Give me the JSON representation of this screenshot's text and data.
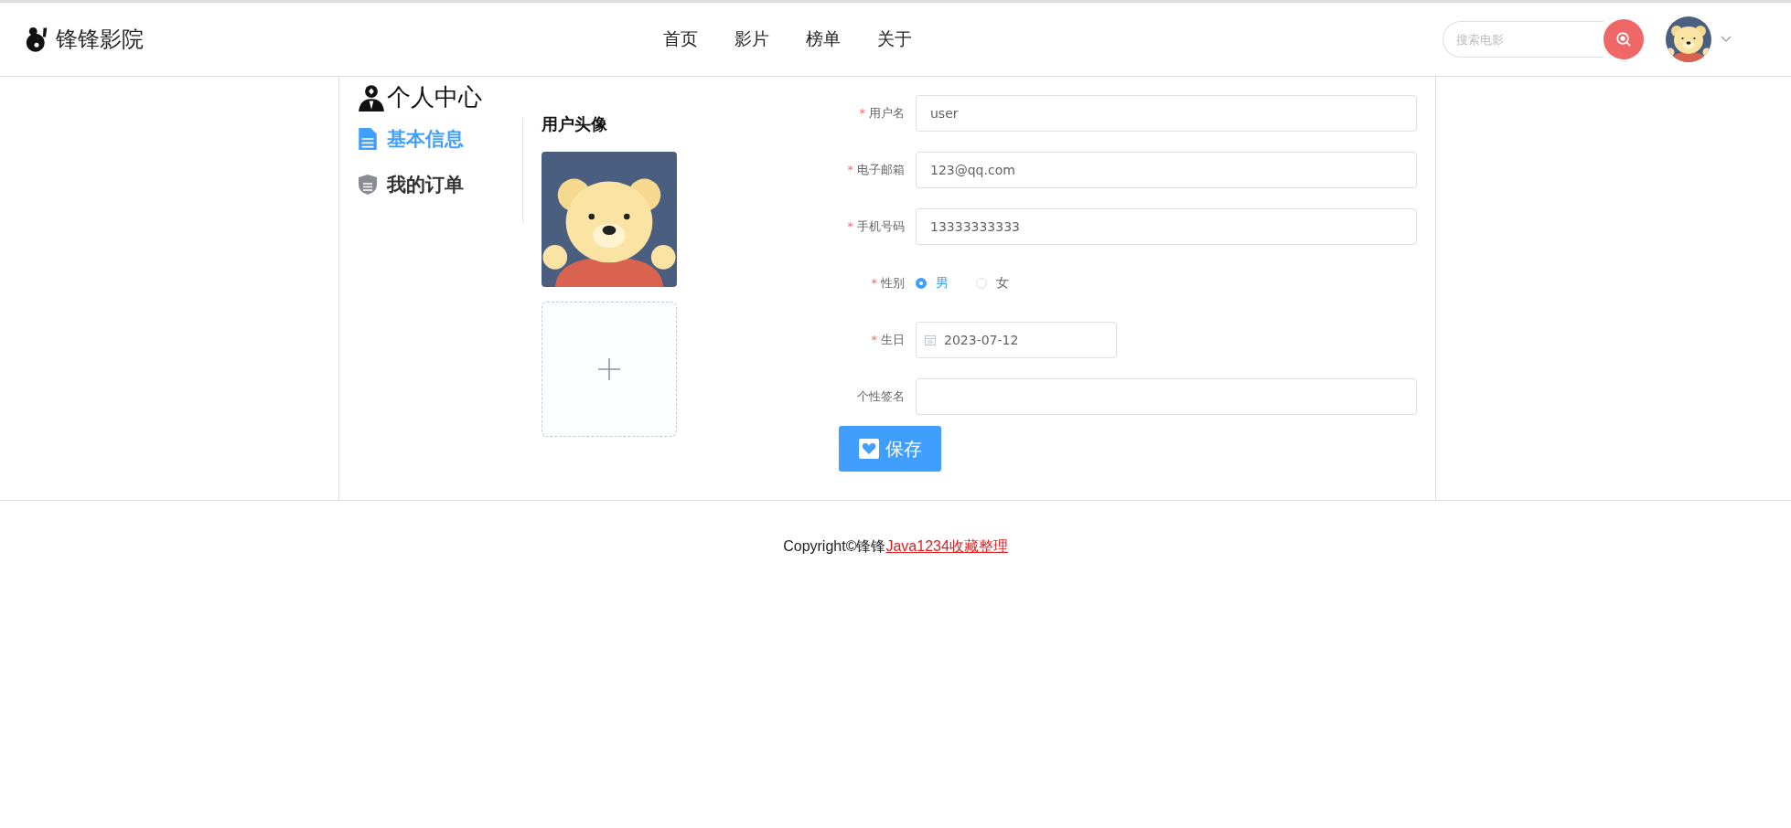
{
  "header": {
    "logo": "锋锋影院",
    "nav": [
      {
        "label": "首页",
        "selected": false
      },
      {
        "label": "影片",
        "selected": false
      },
      {
        "label": "榜单",
        "selected": false
      },
      {
        "label": "关于",
        "selected": false
      }
    ],
    "search": {
      "placeholder": "搜索电影"
    }
  },
  "sidebar": {
    "title": "个人中心",
    "items": [
      {
        "label": "基本信息",
        "selected": true,
        "kind": "info"
      },
      {
        "label": "我的订单",
        "selected": false,
        "kind": "orders"
      }
    ]
  },
  "avatar_section": {
    "title": "用户头像"
  },
  "form": {
    "fields": [
      {
        "label": "用户名",
        "required_mark": "*",
        "kind": "text",
        "value": "user"
      },
      {
        "label": "电子邮箱",
        "required_mark": "*",
        "kind": "text",
        "value": "123@qq.com"
      },
      {
        "label": "手机号码",
        "required_mark": "*",
        "kind": "text",
        "value": "13333333333"
      },
      {
        "label": "性别",
        "required_mark": "*",
        "kind": "radio",
        "options": [
          {
            "label": "男",
            "selected": true
          },
          {
            "label": "女",
            "selected": false
          }
        ]
      },
      {
        "label": "生日",
        "required_mark": "*",
        "kind": "date",
        "value": "2023-07-12"
      },
      {
        "label": "个性签名",
        "kind": "text"
      }
    ],
    "save_button": "保存"
  },
  "footer": {
    "text": "Copyright©锋锋",
    "link": "Java1234收藏整理"
  }
}
